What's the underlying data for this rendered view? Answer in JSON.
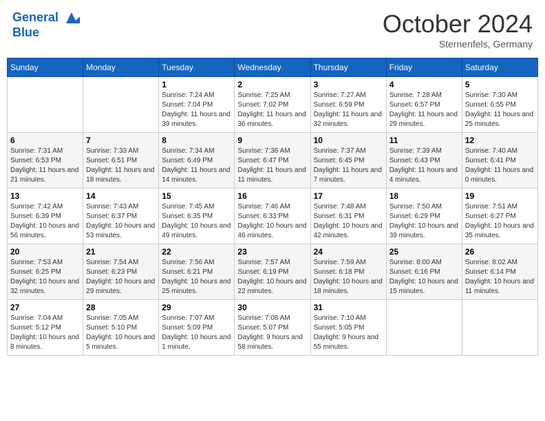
{
  "header": {
    "logo_line1": "General",
    "logo_line2": "Blue",
    "month": "October 2024",
    "location": "Sternenfels, Germany"
  },
  "weekdays": [
    "Sunday",
    "Monday",
    "Tuesday",
    "Wednesday",
    "Thursday",
    "Friday",
    "Saturday"
  ],
  "weeks": [
    [
      {
        "day": "",
        "info": ""
      },
      {
        "day": "",
        "info": ""
      },
      {
        "day": "1",
        "info": "Sunrise: 7:24 AM\nSunset: 7:04 PM\nDaylight: 11 hours and 39 minutes."
      },
      {
        "day": "2",
        "info": "Sunrise: 7:25 AM\nSunset: 7:02 PM\nDaylight: 11 hours and 36 minutes."
      },
      {
        "day": "3",
        "info": "Sunrise: 7:27 AM\nSunset: 6:59 PM\nDaylight: 11 hours and 32 minutes."
      },
      {
        "day": "4",
        "info": "Sunrise: 7:28 AM\nSunset: 6:57 PM\nDaylight: 11 hours and 29 minutes."
      },
      {
        "day": "5",
        "info": "Sunrise: 7:30 AM\nSunset: 6:55 PM\nDaylight: 11 hours and 25 minutes."
      }
    ],
    [
      {
        "day": "6",
        "info": "Sunrise: 7:31 AM\nSunset: 6:53 PM\nDaylight: 11 hours and 21 minutes."
      },
      {
        "day": "7",
        "info": "Sunrise: 7:33 AM\nSunset: 6:51 PM\nDaylight: 11 hours and 18 minutes."
      },
      {
        "day": "8",
        "info": "Sunrise: 7:34 AM\nSunset: 6:49 PM\nDaylight: 11 hours and 14 minutes."
      },
      {
        "day": "9",
        "info": "Sunrise: 7:36 AM\nSunset: 6:47 PM\nDaylight: 11 hours and 11 minutes."
      },
      {
        "day": "10",
        "info": "Sunrise: 7:37 AM\nSunset: 6:45 PM\nDaylight: 11 hours and 7 minutes."
      },
      {
        "day": "11",
        "info": "Sunrise: 7:39 AM\nSunset: 6:43 PM\nDaylight: 11 hours and 4 minutes."
      },
      {
        "day": "12",
        "info": "Sunrise: 7:40 AM\nSunset: 6:41 PM\nDaylight: 11 hours and 0 minutes."
      }
    ],
    [
      {
        "day": "13",
        "info": "Sunrise: 7:42 AM\nSunset: 6:39 PM\nDaylight: 10 hours and 56 minutes."
      },
      {
        "day": "14",
        "info": "Sunrise: 7:43 AM\nSunset: 6:37 PM\nDaylight: 10 hours and 53 minutes."
      },
      {
        "day": "15",
        "info": "Sunrise: 7:45 AM\nSunset: 6:35 PM\nDaylight: 10 hours and 49 minutes."
      },
      {
        "day": "16",
        "info": "Sunrise: 7:46 AM\nSunset: 6:33 PM\nDaylight: 10 hours and 46 minutes."
      },
      {
        "day": "17",
        "info": "Sunrise: 7:48 AM\nSunset: 6:31 PM\nDaylight: 10 hours and 42 minutes."
      },
      {
        "day": "18",
        "info": "Sunrise: 7:50 AM\nSunset: 6:29 PM\nDaylight: 10 hours and 39 minutes."
      },
      {
        "day": "19",
        "info": "Sunrise: 7:51 AM\nSunset: 6:27 PM\nDaylight: 10 hours and 35 minutes."
      }
    ],
    [
      {
        "day": "20",
        "info": "Sunrise: 7:53 AM\nSunset: 6:25 PM\nDaylight: 10 hours and 32 minutes."
      },
      {
        "day": "21",
        "info": "Sunrise: 7:54 AM\nSunset: 6:23 PM\nDaylight: 10 hours and 29 minutes."
      },
      {
        "day": "22",
        "info": "Sunrise: 7:56 AM\nSunset: 6:21 PM\nDaylight: 10 hours and 25 minutes."
      },
      {
        "day": "23",
        "info": "Sunrise: 7:57 AM\nSunset: 6:19 PM\nDaylight: 10 hours and 22 minutes."
      },
      {
        "day": "24",
        "info": "Sunrise: 7:59 AM\nSunset: 6:18 PM\nDaylight: 10 hours and 18 minutes."
      },
      {
        "day": "25",
        "info": "Sunrise: 8:00 AM\nSunset: 6:16 PM\nDaylight: 10 hours and 15 minutes."
      },
      {
        "day": "26",
        "info": "Sunrise: 8:02 AM\nSunset: 6:14 PM\nDaylight: 10 hours and 11 minutes."
      }
    ],
    [
      {
        "day": "27",
        "info": "Sunrise: 7:04 AM\nSunset: 5:12 PM\nDaylight: 10 hours and 8 minutes."
      },
      {
        "day": "28",
        "info": "Sunrise: 7:05 AM\nSunset: 5:10 PM\nDaylight: 10 hours and 5 minutes."
      },
      {
        "day": "29",
        "info": "Sunrise: 7:07 AM\nSunset: 5:09 PM\nDaylight: 10 hours and 1 minute."
      },
      {
        "day": "30",
        "info": "Sunrise: 7:08 AM\nSunset: 5:07 PM\nDaylight: 9 hours and 58 minutes."
      },
      {
        "day": "31",
        "info": "Sunrise: 7:10 AM\nSunset: 5:05 PM\nDaylight: 9 hours and 55 minutes."
      },
      {
        "day": "",
        "info": ""
      },
      {
        "day": "",
        "info": ""
      }
    ]
  ]
}
